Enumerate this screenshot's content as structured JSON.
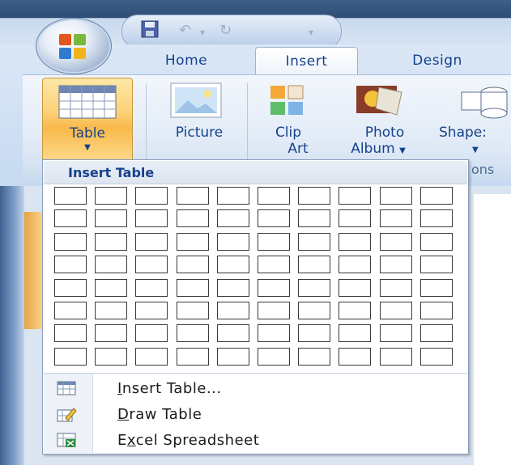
{
  "ribbon": {
    "tabs": [
      {
        "label": "Home"
      },
      {
        "label": "Insert"
      },
      {
        "label": "Design"
      }
    ],
    "buttons": {
      "table": {
        "label": "Table"
      },
      "picture": {
        "label": "Picture"
      },
      "clip_art": {
        "line1": "Clip",
        "line2": "Art"
      },
      "photo_album": {
        "line1": "Photo",
        "line2": "Album"
      },
      "shapes": {
        "label": "Shape:"
      }
    },
    "group_label_fragment": "ons"
  },
  "dropdown": {
    "title": "Insert Table",
    "grid": {
      "columns": 10,
      "rows": 8
    },
    "items": [
      {
        "label": "Insert Table...",
        "mnemonic": "I",
        "icon": "table-grid-icon"
      },
      {
        "label": "Draw Table",
        "mnemonic": "D",
        "icon": "draw-table-pencil-icon"
      },
      {
        "label": "Excel Spreadsheet",
        "mnemonic": "x",
        "icon": "excel-spreadsheet-icon"
      }
    ]
  },
  "colors": {
    "ribbon_text": "#15428b",
    "active_button": "#fbd27a",
    "cell_border": "#3a3a3a"
  }
}
